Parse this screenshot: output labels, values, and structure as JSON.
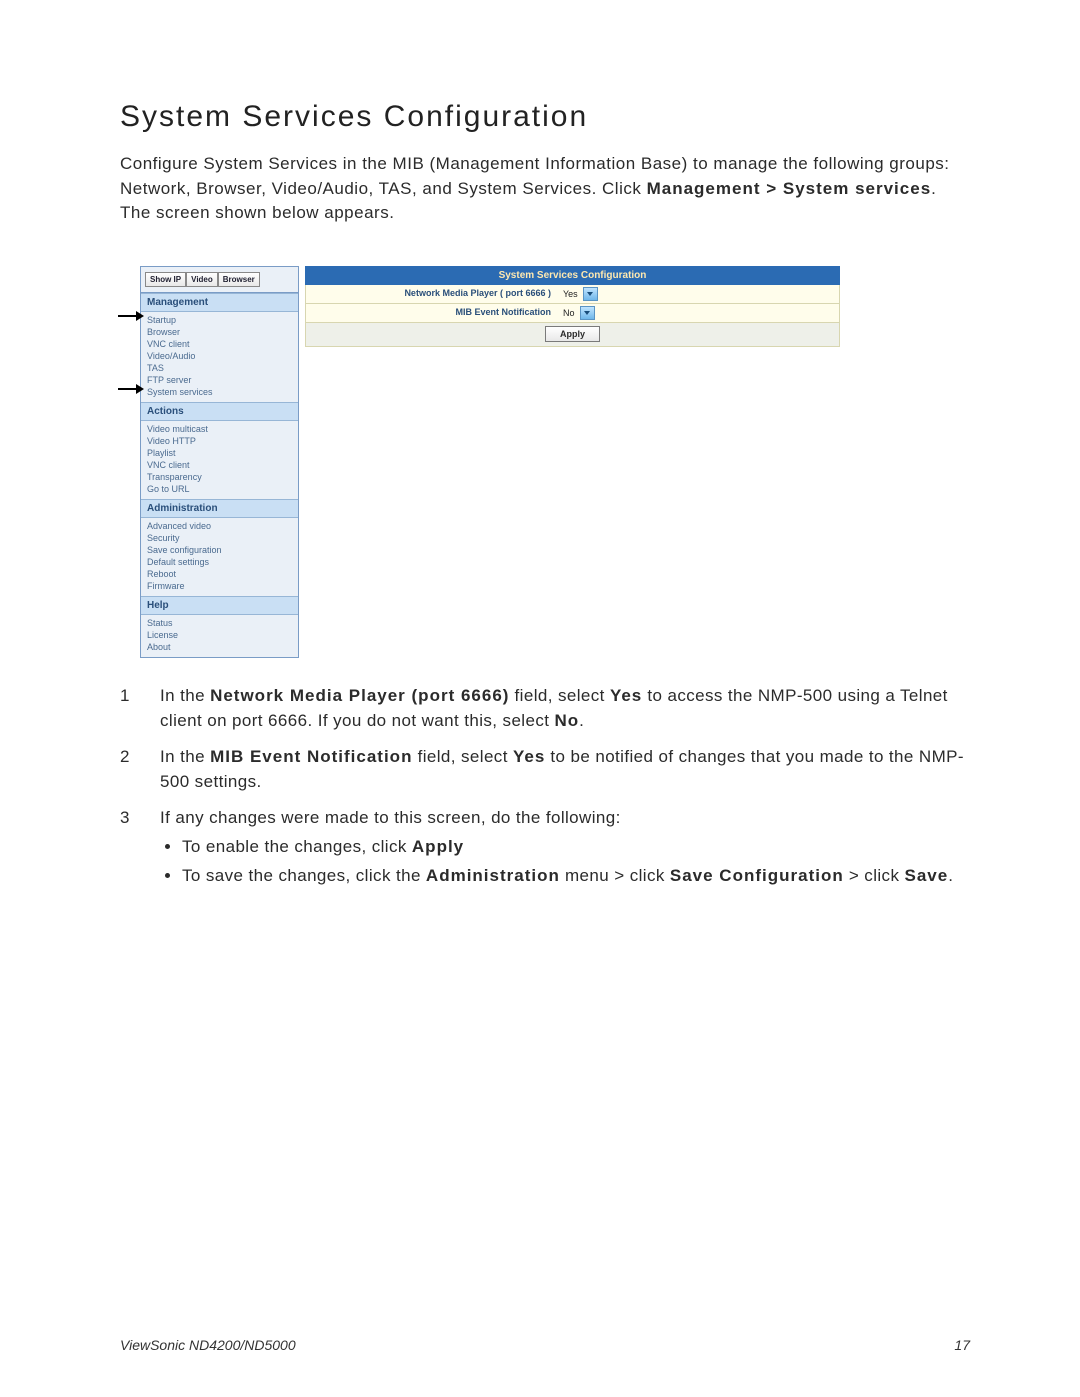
{
  "title": "System Services Configuration",
  "intro_plain_1": "Configure System Services in the MIB (Management Information Base) to manage the following groups: Network, Browser, Video/Audio, TAS, and System Services. Click ",
  "intro_bold": "Management > System services",
  "intro_plain_2": ". The screen shown below appears.",
  "sidebar": {
    "tabs": {
      "show_ip": "Show IP",
      "video": "Video",
      "browser": "Browser"
    },
    "sections": [
      {
        "head": "Management",
        "items": [
          "Startup",
          "Browser",
          "VNC client",
          "Video/Audio",
          "TAS",
          "FTP server",
          "System services"
        ]
      },
      {
        "head": "Actions",
        "items": [
          "Video multicast",
          "Video HTTP",
          "Playlist",
          "VNC client",
          "Transparency",
          "Go to URL"
        ]
      },
      {
        "head": "Administration",
        "items": [
          "Advanced video",
          "Security",
          "Save configuration",
          "Default settings",
          "Reboot",
          "Firmware"
        ]
      },
      {
        "head": "Help",
        "items": [
          "Status",
          "License",
          "About"
        ]
      }
    ]
  },
  "main": {
    "header": "System Services Configuration",
    "row1_label": "Network Media Player ( port 6666 )",
    "row1_value": "Yes",
    "row2_label": "MIB Event Notification",
    "row2_value": "No",
    "apply": "Apply"
  },
  "steps": {
    "s1_pre": "In the ",
    "s1_b1": "Network Media Player (port 6666)",
    "s1_mid": " field, select ",
    "s1_b2": "Yes",
    "s1_mid2": " to access the NMP-500 using a Telnet client on port 6666. If you do not want this, select ",
    "s1_b3": "No",
    "s1_end": ".",
    "s2_pre": "In the ",
    "s2_b1": "MIB Event Notification",
    "s2_mid": " field, select ",
    "s2_b2": "Yes",
    "s2_end": " to be notified of changes that you made to the NMP-500 settings.",
    "s3_line": "If any changes were made to this screen, do the following:",
    "s3_bullet1_pre": "To enable the changes, click ",
    "s3_bullet1_b": "Apply",
    "s3_bullet2_pre": "To save the changes, click the ",
    "s3_bullet2_b1": "Administration",
    "s3_bullet2_mid1": " menu > click ",
    "s3_bullet2_b2": "Save Configuration",
    "s3_bullet2_mid2": " > click ",
    "s3_bullet2_b3": "Save",
    "s3_bullet2_end": "."
  },
  "footer": {
    "left": "ViewSonic ND4200/ND5000",
    "right": "17"
  }
}
